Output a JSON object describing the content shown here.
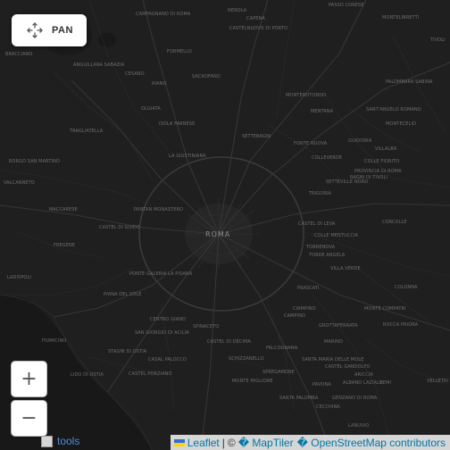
{
  "map": {
    "city_label": "ROMA",
    "places": [
      {
        "name": "CAMPAGNANO DI ROMA"
      },
      {
        "name": "NEROLA"
      },
      {
        "name": "PASSO CORESE"
      },
      {
        "name": "MONTELIBRETTI"
      },
      {
        "name": "CAPENA"
      },
      {
        "name": "CASTELNUOVO DI PORTO"
      },
      {
        "name": "MENTANA"
      },
      {
        "name": "MONTEROTONDO"
      },
      {
        "name": "PALOMBARA SABINA"
      },
      {
        "name": "GUIDONIA"
      },
      {
        "name": "SANT'ANGELO ROMANO"
      },
      {
        "name": "MONTECELIO"
      },
      {
        "name": "TIVOLI"
      },
      {
        "name": "FORMELLO"
      },
      {
        "name": "SACROFANO"
      },
      {
        "name": "RIANO"
      },
      {
        "name": "CESANO"
      },
      {
        "name": "ANGUILLARA SABAZIA"
      },
      {
        "name": "BRACCIANO"
      },
      {
        "name": "OLGIATA"
      },
      {
        "name": "ISOLA FARNESE"
      },
      {
        "name": "LA GIUSTINIANA"
      },
      {
        "name": "SETTEBAGNI"
      },
      {
        "name": "FONTE NUOVA"
      },
      {
        "name": "COLLEVERDE"
      },
      {
        "name": "VILLALBA"
      },
      {
        "name": "BAGNI DI TIVOLI"
      },
      {
        "name": "COLLE FIORITO"
      },
      {
        "name": "PROVINCIA DI ROMA"
      },
      {
        "name": "SETTEVILLE NORD"
      },
      {
        "name": "CORCOLLE"
      },
      {
        "name": "TRIGORIA"
      },
      {
        "name": "CASTEL DI LEVA"
      },
      {
        "name": "TORRENOVA"
      },
      {
        "name": "TORRE ANGELA"
      },
      {
        "name": "VILLA VERDE"
      },
      {
        "name": "COLLE MENTUCCIA"
      },
      {
        "name": "COLONNA"
      },
      {
        "name": "MONTE COMPATRI"
      },
      {
        "name": "ROCCA PRIORA"
      },
      {
        "name": "FRASCATI"
      },
      {
        "name": "GROTTAFERRATA"
      },
      {
        "name": "MARINO"
      },
      {
        "name": "CASTEL GANDOLFO"
      },
      {
        "name": "ALBANO LAZIALE"
      },
      {
        "name": "GENZANO DI ROMA"
      },
      {
        "name": "ARICCIA"
      },
      {
        "name": "NEMI"
      },
      {
        "name": "VELLETRI"
      },
      {
        "name": "CAMPINO"
      },
      {
        "name": "CIAMPINO"
      },
      {
        "name": "FALCOGNANA"
      },
      {
        "name": "SPINACETO"
      },
      {
        "name": "CASTEL DI DECIMA"
      },
      {
        "name": "CENTRO GIANO"
      },
      {
        "name": "SAN GIORGIO DI ACILIA"
      },
      {
        "name": "PONTE GALERIA LA PISANA"
      },
      {
        "name": "FIUMICINO"
      },
      {
        "name": "STAGNI DI OSTIA"
      },
      {
        "name": "CASAL PALOCCO"
      },
      {
        "name": "LIDO DI OSTIA"
      },
      {
        "name": "CASTEL PORZIANO"
      },
      {
        "name": "PIANA DEL SOLE"
      },
      {
        "name": "PANTAN MONASTERO"
      },
      {
        "name": "CASTEL DI GUIDO"
      },
      {
        "name": "MACCARESE"
      },
      {
        "name": "FREGENE"
      },
      {
        "name": "TRAGLIATELLA"
      },
      {
        "name": "BORGO SAN MARTINO"
      },
      {
        "name": "VALCANNETO"
      },
      {
        "name": "LADISPOLI"
      },
      {
        "name": "SCHIZZANELLO"
      },
      {
        "name": "SPREGAMORE"
      },
      {
        "name": "MONTE MIGLIORE"
      },
      {
        "name": "SANTA PALOMBA"
      },
      {
        "name": "CECCHINA"
      },
      {
        "name": "PAVONA"
      },
      {
        "name": "LANUVIO"
      },
      {
        "name": "SANTA MARIA DELLE MOLE"
      }
    ]
  },
  "controls": {
    "pan_label": "PAN",
    "zoom_in_label": "+",
    "zoom_out_label": "−",
    "tools_label": "tools"
  },
  "attribution": {
    "leaflet": "Leaflet",
    "copyright": "©",
    "maptiler": "� MapTiler",
    "osm": "� OpenStreetMap contributors"
  }
}
